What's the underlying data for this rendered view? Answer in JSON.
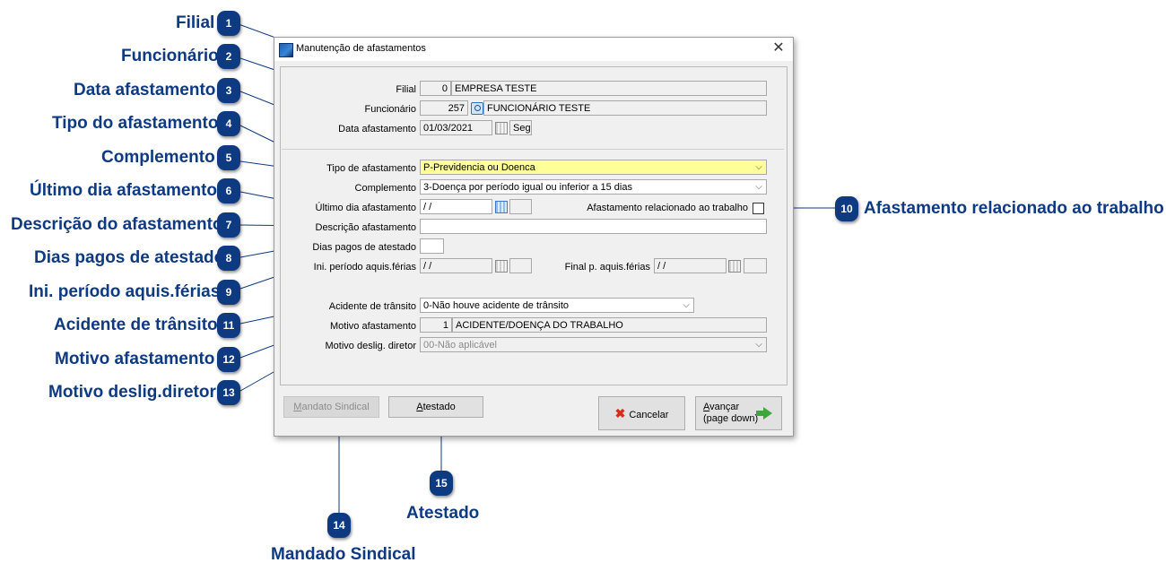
{
  "callouts": [
    {
      "num": "1",
      "label": "Filial"
    },
    {
      "num": "2",
      "label": "Funcionário"
    },
    {
      "num": "3",
      "label": "Data afastamento"
    },
    {
      "num": "4",
      "label": "Tipo do afastamento"
    },
    {
      "num": "5",
      "label": "Complemento"
    },
    {
      "num": "6",
      "label": "Último dia afastamento"
    },
    {
      "num": "7",
      "label": "Descrição do afastamento"
    },
    {
      "num": "8",
      "label": "Dias pagos de atestado"
    },
    {
      "num": "9",
      "label": "Ini. período aquis.férias"
    },
    {
      "num": "10",
      "label": "Afastamento relacionado ao trabalho"
    },
    {
      "num": "11",
      "label": "Acidente de trânsito"
    },
    {
      "num": "12",
      "label": "Motivo afastamento"
    },
    {
      "num": "13",
      "label": "Motivo deslig.diretor"
    },
    {
      "num": "14",
      "label": "Mandado Sindical"
    },
    {
      "num": "15",
      "label": "Atestado"
    }
  ],
  "dialog": {
    "title": "Manutenção de afastamentos",
    "close_glyph": "✕",
    "fields": {
      "filial": {
        "label": "Filial",
        "code": "0",
        "name": "EMPRESA TESTE"
      },
      "funcionario": {
        "label": "Funcionário",
        "code": "257",
        "name": "FUNCIONÁRIO TESTE"
      },
      "data_afastamento": {
        "label": "Data afastamento",
        "value": "01/03/2021",
        "weekday": "Seg"
      },
      "tipo_afastamento": {
        "label": "Tipo de afastamento",
        "value": "P-Previdencia ou Doenca"
      },
      "complemento": {
        "label": "Complemento",
        "value": "3-Doença por período igual ou inferior a 15 dias"
      },
      "ultimo_dia": {
        "label": "Último dia afastamento",
        "value": " /  /"
      },
      "relacionado_trabalho": {
        "label": "Afastamento relacionado ao trabalho",
        "checked": false
      },
      "descricao": {
        "label": "Descrição afastamento",
        "value": ""
      },
      "dias_pagos": {
        "label": "Dias pagos de atestado",
        "value": ""
      },
      "ini_periodo": {
        "label": "Ini. período aquis.férias",
        "value": " /  /"
      },
      "final_periodo": {
        "label": "Final p. aquis.férias",
        "value": " /  /"
      },
      "acidente_transito": {
        "label": "Acidente de trânsito",
        "value": "0-Não houve acidente de trânsito"
      },
      "motivo_afastamento": {
        "label": "Motivo afastamento",
        "code": "1",
        "name": "ACIDENTE/DOENÇA DO TRABALHO"
      },
      "motivo_deslig_diretor": {
        "label": "Motivo deslig. diretor",
        "value": "00-Não aplicável"
      }
    },
    "buttons": {
      "mandato_sindical": {
        "u": "M",
        "rest": "andato Sindical"
      },
      "atestado": {
        "u": "A",
        "rest": "testado"
      },
      "cancelar": {
        "label": "Cancelar"
      },
      "avancar": {
        "u": "A",
        "rest": "vançar",
        "line2": "(page down)"
      }
    }
  },
  "colors": {
    "callout": "#0e3a82",
    "required_field": "#ffff99",
    "cancel_icon": "#d62c1c",
    "advance_icon": "#3aa93a"
  },
  "icons": [
    "app-icon",
    "close-icon",
    "search-icon",
    "calendar-icon",
    "chevron-down-icon",
    "cancel-x-icon",
    "arrow-right-icon"
  ]
}
